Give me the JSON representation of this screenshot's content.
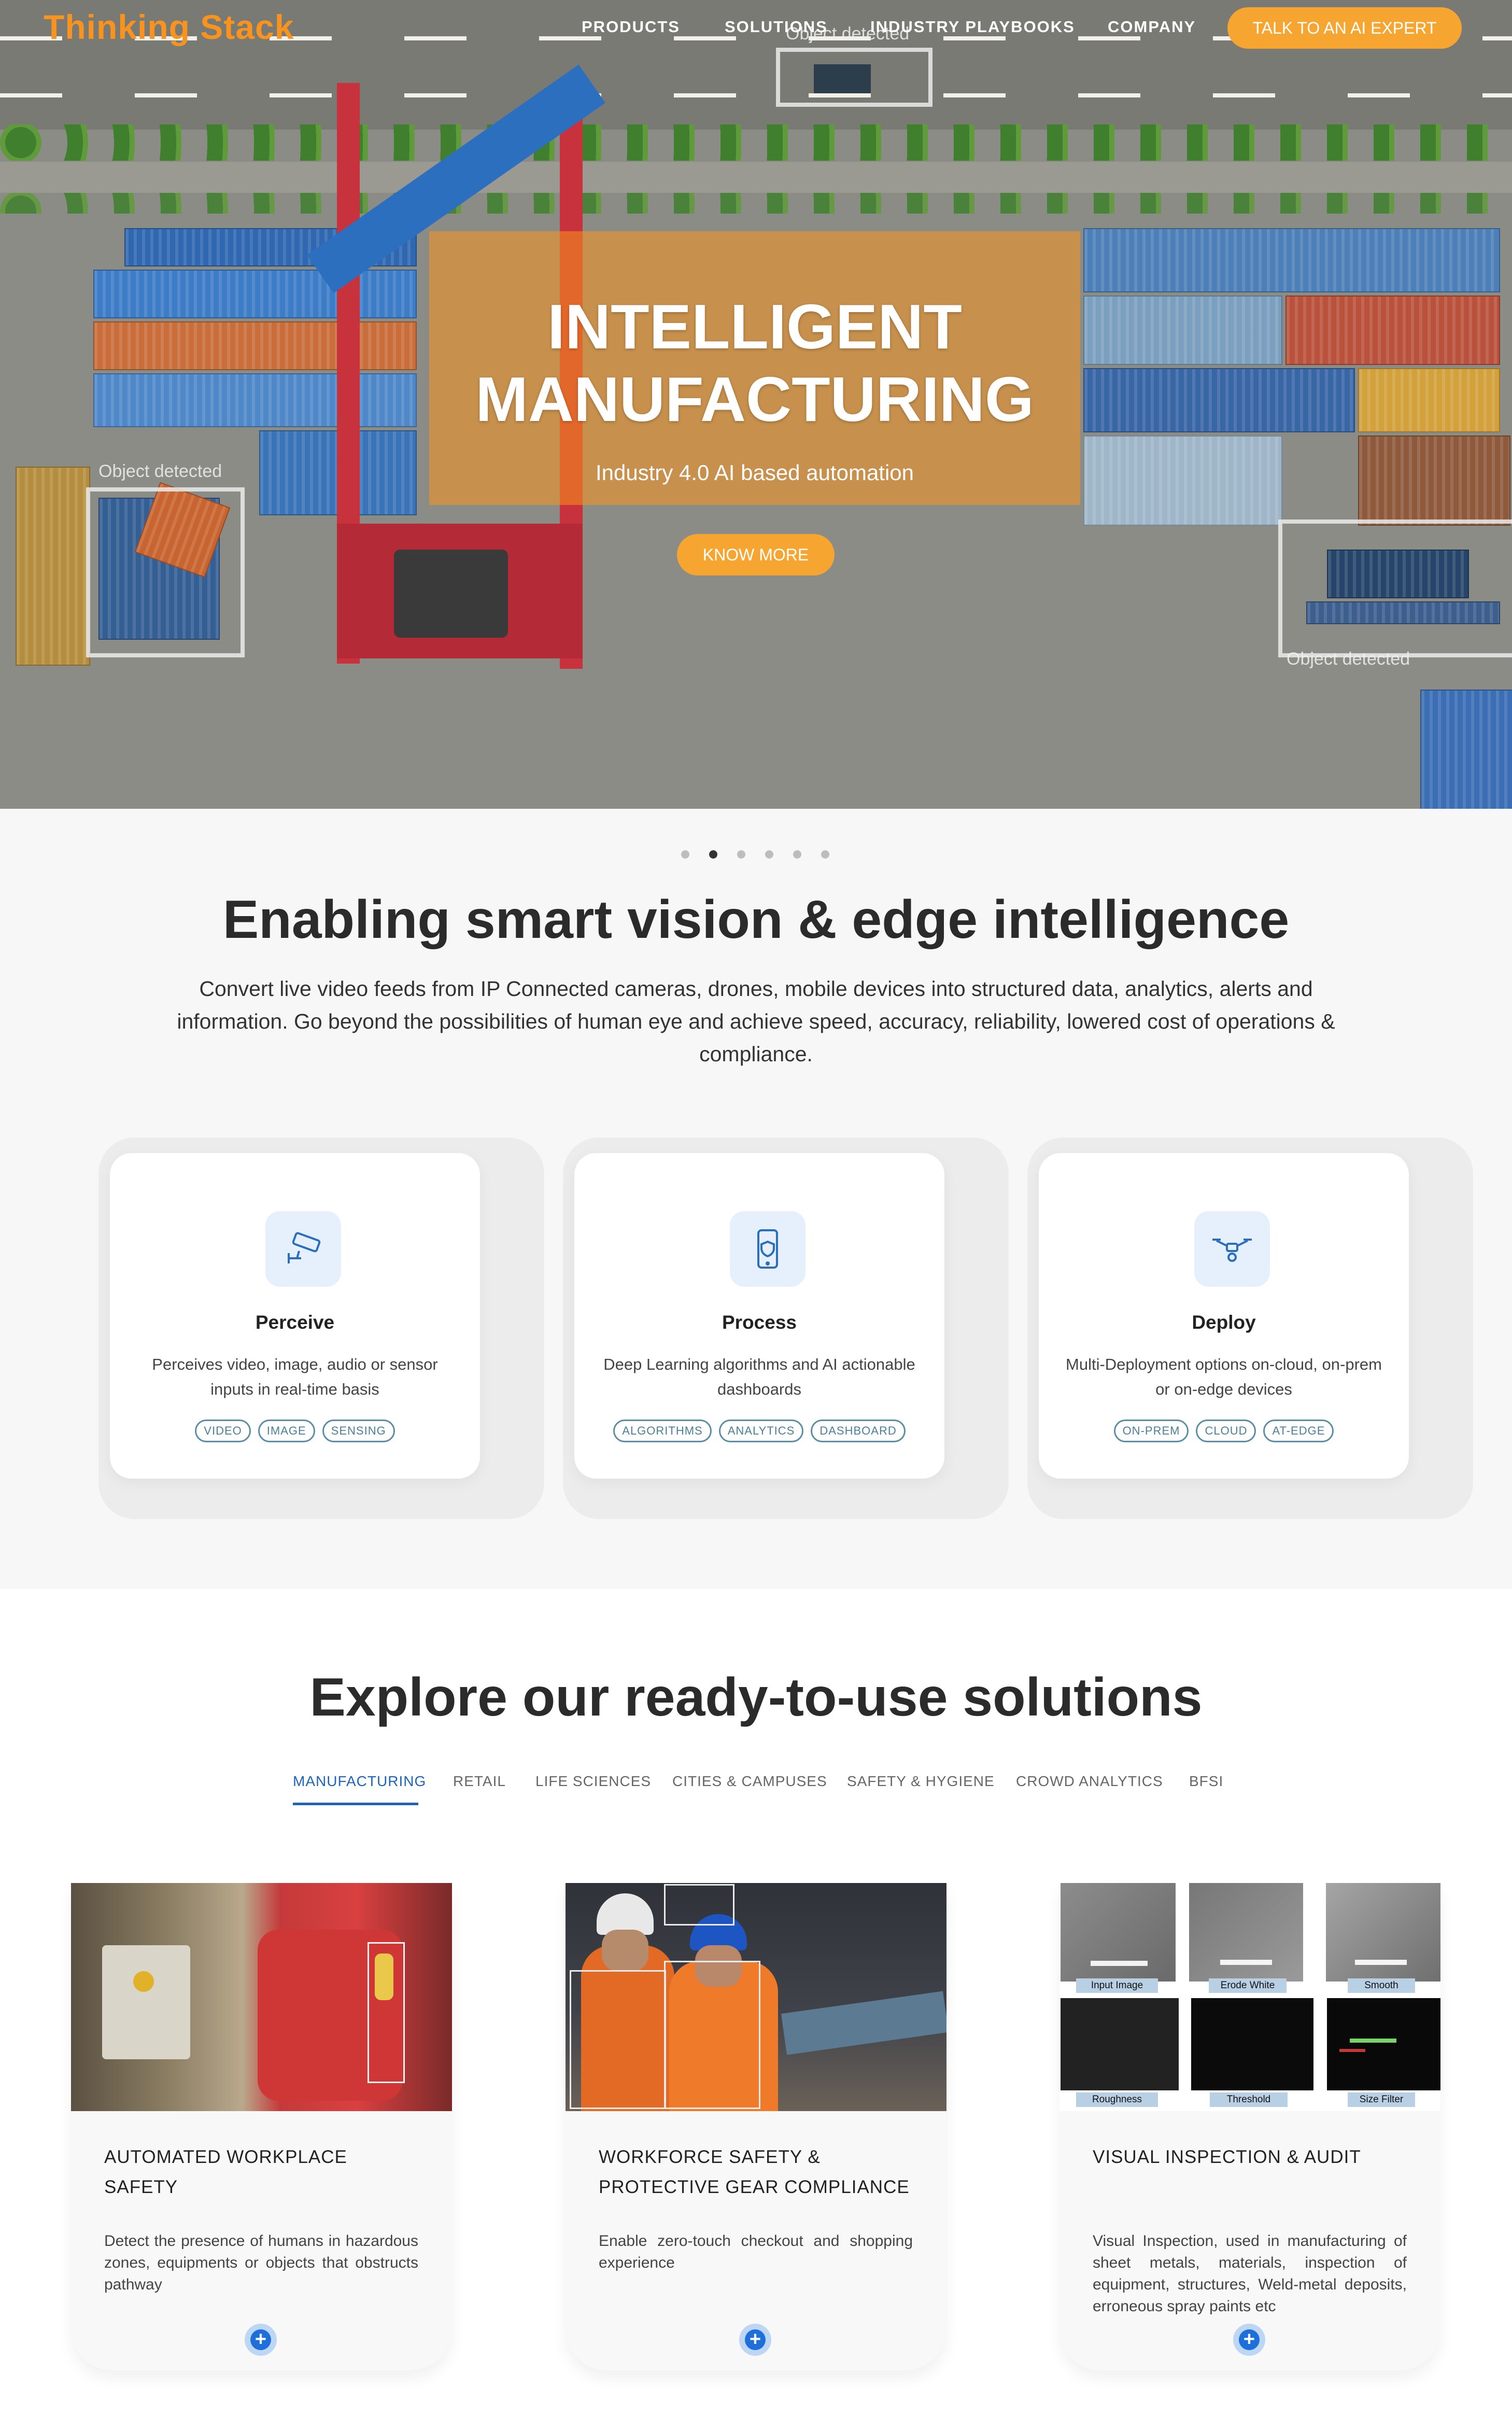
{
  "brand": {
    "logo_text": "Thinking Stack",
    "accent": "#f7931e",
    "link_blue": "#1f64b8"
  },
  "nav": {
    "items": [
      "PRODUCTS",
      "SOLUTIONS",
      "INDUSTRY PLAYBOOKS",
      "COMPANY"
    ],
    "cta": "TALK TO AN AI EXPERT"
  },
  "hero": {
    "title_line1": "INTELLIGENT",
    "title_line2": "MANUFACTURING",
    "subtitle": "Industry 4.0 AI based automation",
    "button": "KNOW MORE",
    "detection_labels": [
      "Object detected",
      "Object detected",
      "Object detected"
    ],
    "slides_total": 6,
    "active_slide": 2
  },
  "vision": {
    "title": "Enabling smart vision & edge intelligence",
    "description": "Convert live video feeds from IP Connected cameras, drones, mobile devices into structured data, analytics, alerts and information. Go beyond the possibilities of human eye and achieve speed, accuracy, reliability, lowered cost of operations & compliance.",
    "features": [
      {
        "icon": "cctv-camera-icon",
        "title": "Perceive",
        "desc": "Perceives video, image, audio or sensor inputs in real-time basis",
        "tags": [
          "VIDEO",
          "IMAGE",
          "SENSING"
        ]
      },
      {
        "icon": "mobile-shield-icon",
        "title": "Process",
        "desc": "Deep Learning algorithms and AI actionable dashboards",
        "tags": [
          "ALGORITHMS",
          "ANALYTICS",
          "DASHBOARD"
        ]
      },
      {
        "icon": "drone-icon",
        "title": "Deploy",
        "desc": "Multi-Deployment options on-cloud, on-prem or on-edge devices",
        "tags": [
          "ON-PREM",
          "CLOUD",
          "AT-EDGE"
        ]
      }
    ]
  },
  "solutions": {
    "title": "Explore our ready-to-use solutions",
    "tabs": [
      "MANUFACTURING",
      "RETAIL",
      "LIFE SCIENCES",
      "CITIES & CAMPUSES",
      "SAFETY & HYGIENE",
      "CROWD ANALYTICS",
      "BFSI"
    ],
    "active_tab": 0,
    "cards": [
      {
        "title": "AUTOMATED WORKPLACE SAFETY",
        "desc": "Detect the presence of humans in hazardous zones, equipments or objects that obstructs pathway"
      },
      {
        "title": "WORKFORCE SAFETY & PROTECTIVE GEAR COMPLIANCE",
        "desc": "Enable zero-touch checkout and shopping experience"
      },
      {
        "title": "VISUAL INSPECTION & AUDIT",
        "desc": "Visual Inspection, used in manufacturing of sheet metals, materials, inspection of equipment, structures, Weld-metal deposits, erroneous spray paints etc"
      }
    ],
    "inspection_labels": [
      "Input Image",
      "Erode White",
      "Smooth",
      "Roughness",
      "Threshold",
      "Size Filter"
    ],
    "plus_symbol": "+"
  }
}
